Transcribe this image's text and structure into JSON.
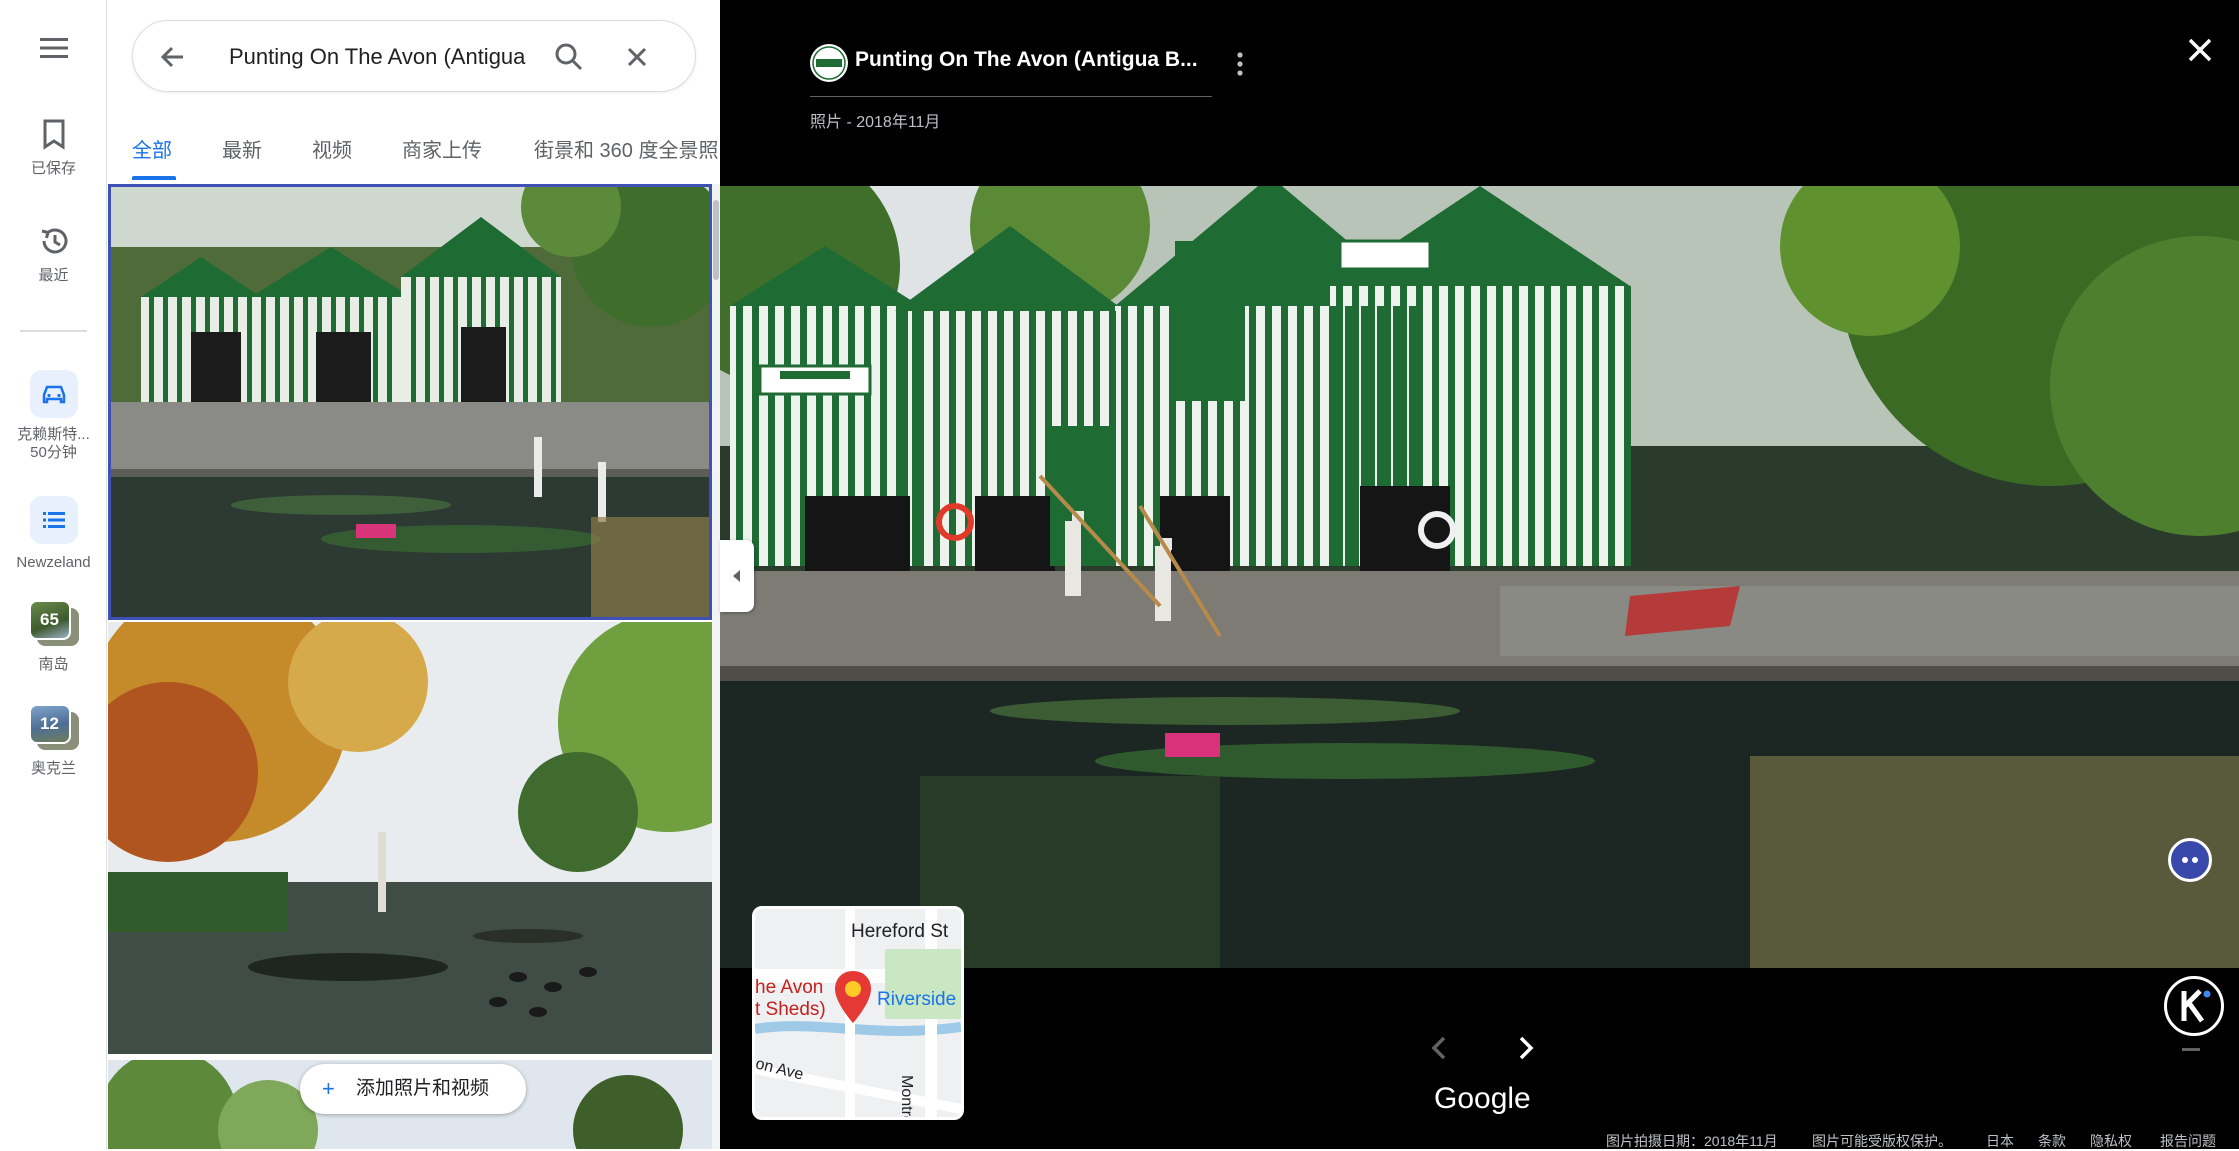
{
  "rail": {
    "saved_label": "已保存",
    "recent_label": "最近",
    "trip_label": "克赖斯特...",
    "trip_time": "50分钟",
    "list_label": "Newzeland",
    "collection1_count": "65",
    "collection1_label": "南岛",
    "collection2_count": "12",
    "collection2_label": "奥克兰"
  },
  "search": {
    "value": "Punting On The Avon (Antigua"
  },
  "tabs": [
    {
      "label": "全部",
      "active": true
    },
    {
      "label": "最新"
    },
    {
      "label": "视频"
    },
    {
      "label": "商家上传"
    },
    {
      "label": "街景和 360 度全景照"
    }
  ],
  "add_button_label": "添加照片和视频",
  "viewer": {
    "title": "Punting On The Avon (Antigua B...",
    "subtitle": "照片 - 2018年11月",
    "brand": "Google",
    "map": {
      "street1": "Hereford St",
      "place1": "he Avon",
      "place2": "t Sheds)",
      "place3": "Riverside",
      "street2": "on Ave",
      "street3": "Montre"
    },
    "footer": {
      "date": "图片拍摄日期：2018年11月",
      "copyright": "图片可能受版权保护。",
      "region": "日本",
      "terms": "条款",
      "privacy": "隐私权",
      "report": "报告问题"
    }
  }
}
